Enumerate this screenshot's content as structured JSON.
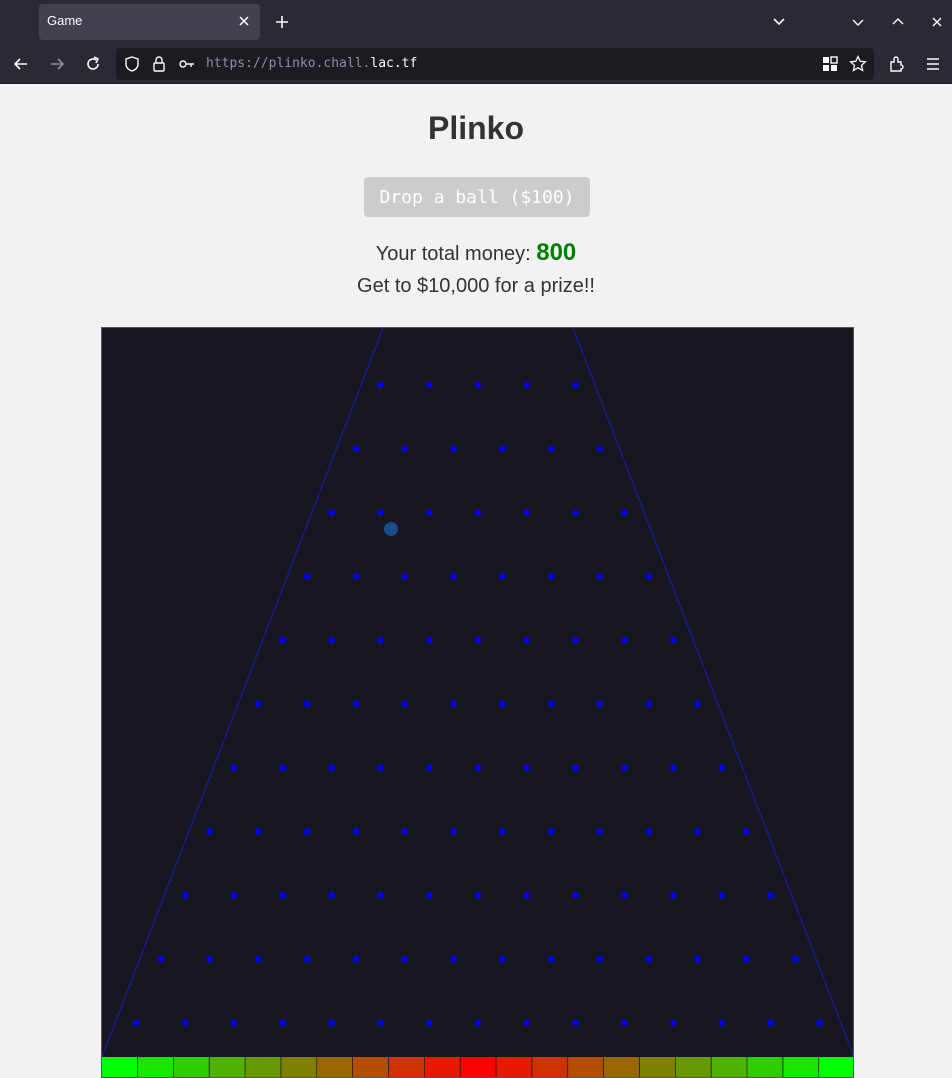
{
  "browser": {
    "tab_title": "Game",
    "url_scheme": "https://plinko.chall.",
    "url_host": "lac.tf"
  },
  "page": {
    "title": "Plinko",
    "drop_button_label": "Drop a ball ($100)",
    "money_label": "Your total money:",
    "money_value": "800",
    "prize_text": "Get to $10,000 for a prize!!"
  },
  "game": {
    "peg_rows": 11,
    "first_row_pegs": 5,
    "peg_color": "#0000ff",
    "ball_color": "#1a4a8a",
    "wall_color": "#1a1a8a",
    "board_bg": "#161620",
    "slot_colors": [
      "#00ff00",
      "#1ae600",
      "#33cc00",
      "#4db300",
      "#669900",
      "#808000",
      "#996600",
      "#b34d00",
      "#cc3300",
      "#e61a00",
      "#ff0000",
      "#e61a00",
      "#cc3300",
      "#b34d00",
      "#996600",
      "#808000",
      "#669900",
      "#4db300",
      "#33cc00",
      "#1ae600",
      "#00ff00"
    ]
  }
}
